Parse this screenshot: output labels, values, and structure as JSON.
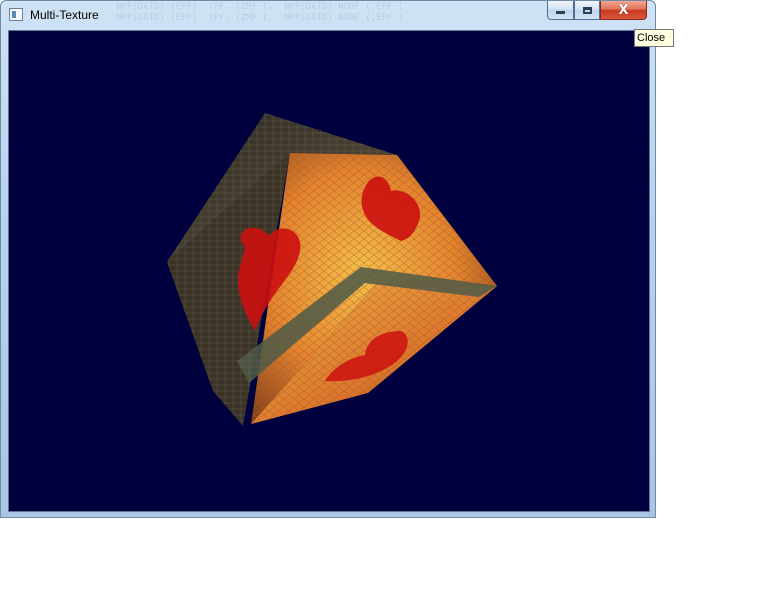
{
  "window": {
    "title": "Multi-Texture",
    "title_background_text": "NPP(DATD) (EPF)  (PF, (ZMF (,  NPP(DATD) NORF (,EPF (\nNPP(DATD) (EPF)  (PF, (ZMF (,  NPP(DATD) NORF (,EPF (",
    "icon": "application-window-icon"
  },
  "caption_buttons": {
    "minimize_icon": "minimize-icon",
    "maximize_icon": "maximize-icon",
    "close_label": "X"
  },
  "tooltip": {
    "text": "Close"
  },
  "viewport": {
    "background_color": "#00003f",
    "content": "textured-cube",
    "texture_colors": {
      "warm_face": "#e8a23a",
      "heart": "#cc1010",
      "brick_dark": "#3b3326"
    }
  }
}
